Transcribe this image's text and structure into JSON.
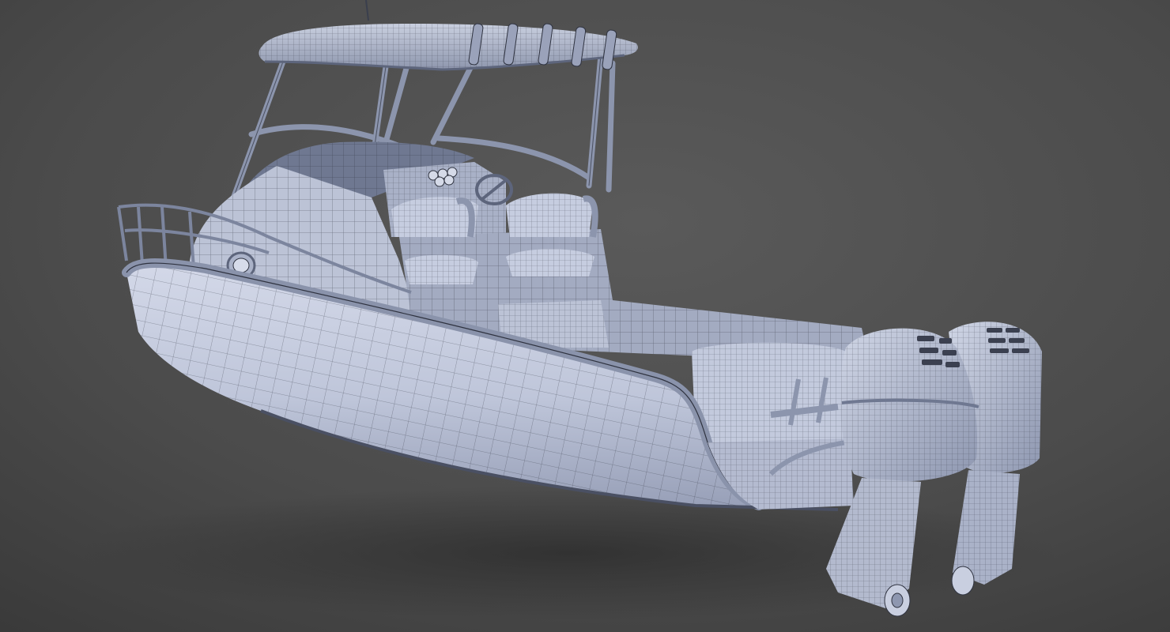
{
  "scene": {
    "subject": "wireframe-boat-render",
    "palette": {
      "background_top": "#575757",
      "background_bottom": "#3b3b3b",
      "hull_light": "#c9cfe0",
      "hull_mid": "#aab2c8",
      "hull_dark": "#7c859e",
      "wire": "#2f3340",
      "shadow": "#2e2e2e"
    },
    "parts": [
      "hardtop-canopy",
      "rod-holders",
      "t-top-frame",
      "windshield",
      "bow-rail",
      "cabin-porthole",
      "helm-console",
      "steering-wheel",
      "helm-seats",
      "cockpit-floor",
      "transom-cooler",
      "hull-side",
      "twin-outboard-engines"
    ]
  }
}
